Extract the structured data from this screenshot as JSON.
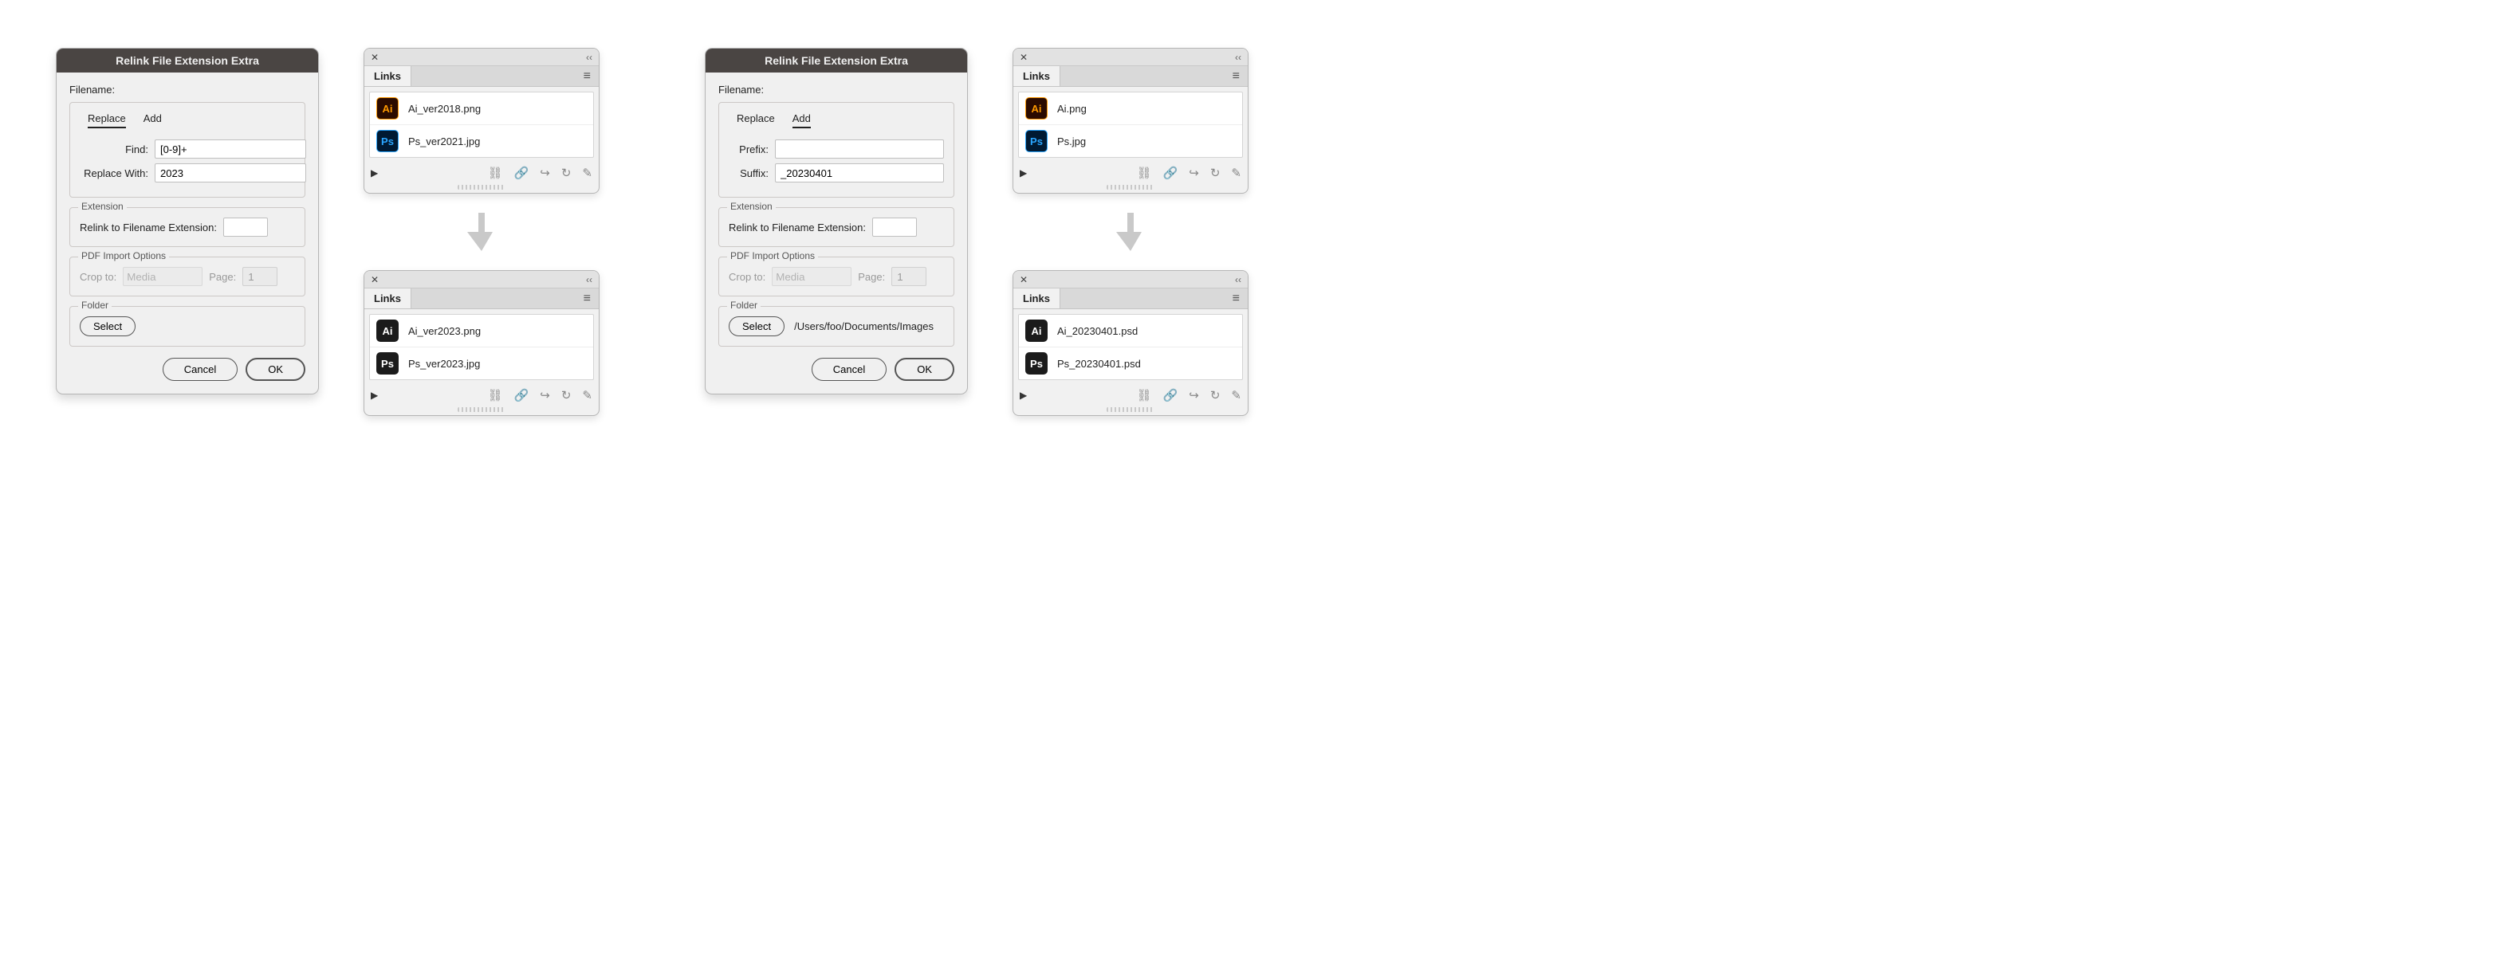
{
  "dialog1": {
    "title": "Relink File Extension Extra",
    "filename_label": "Filename:",
    "tabs": {
      "replace": "Replace",
      "add": "Add",
      "active": "replace"
    },
    "find_label": "Find:",
    "find_value": "[0-9]+",
    "replace_label": "Replace With:",
    "replace_value": "2023",
    "ext_group": "Extension",
    "ext_label": "Relink to Filename Extension:",
    "ext_value": "",
    "pdf_group": "PDF Import Options",
    "crop_label": "Crop to:",
    "crop_value": "Media",
    "page_label": "Page:",
    "page_value": "1",
    "folder_group": "Folder",
    "select_btn": "Select",
    "folder_path": "",
    "cancel": "Cancel",
    "ok": "OK"
  },
  "dialog2": {
    "title": "Relink File Extension Extra",
    "filename_label": "Filename:",
    "tabs": {
      "replace": "Replace",
      "add": "Add",
      "active": "add"
    },
    "prefix_label": "Prefix:",
    "prefix_value": "",
    "suffix_label": "Suffix:",
    "suffix_value": "_20230401",
    "ext_group": "Extension",
    "ext_label": "Relink to Filename Extension:",
    "ext_value": "",
    "pdf_group": "PDF Import Options",
    "crop_label": "Crop to:",
    "crop_value": "Media",
    "page_label": "Page:",
    "page_value": "1",
    "folder_group": "Folder",
    "select_btn": "Select",
    "folder_path": "/Users/foo/Documents/Images",
    "cancel": "Cancel",
    "ok": "OK"
  },
  "links_label": "Links",
  "panel1_before": [
    {
      "icon": "ai-orange",
      "text": "Ai",
      "name": "Ai_ver2018.png"
    },
    {
      "icon": "ps-blue",
      "text": "Ps",
      "name": "Ps_ver2021.jpg"
    }
  ],
  "panel1_after": [
    {
      "icon": "ai-white",
      "text": "Ai",
      "name": "Ai_ver2023.png"
    },
    {
      "icon": "ps-white",
      "text": "Ps",
      "name": "Ps_ver2023.jpg"
    }
  ],
  "panel2_before": [
    {
      "icon": "ai-orange",
      "text": "Ai",
      "name": "Ai.png"
    },
    {
      "icon": "ps-blue",
      "text": "Ps",
      "name": "Ps.jpg"
    }
  ],
  "panel2_after": [
    {
      "icon": "ai-white",
      "text": "Ai",
      "name": "Ai_20230401.psd"
    },
    {
      "icon": "ps-white",
      "text": "Ps",
      "name": "Ps_20230401.psd"
    }
  ]
}
